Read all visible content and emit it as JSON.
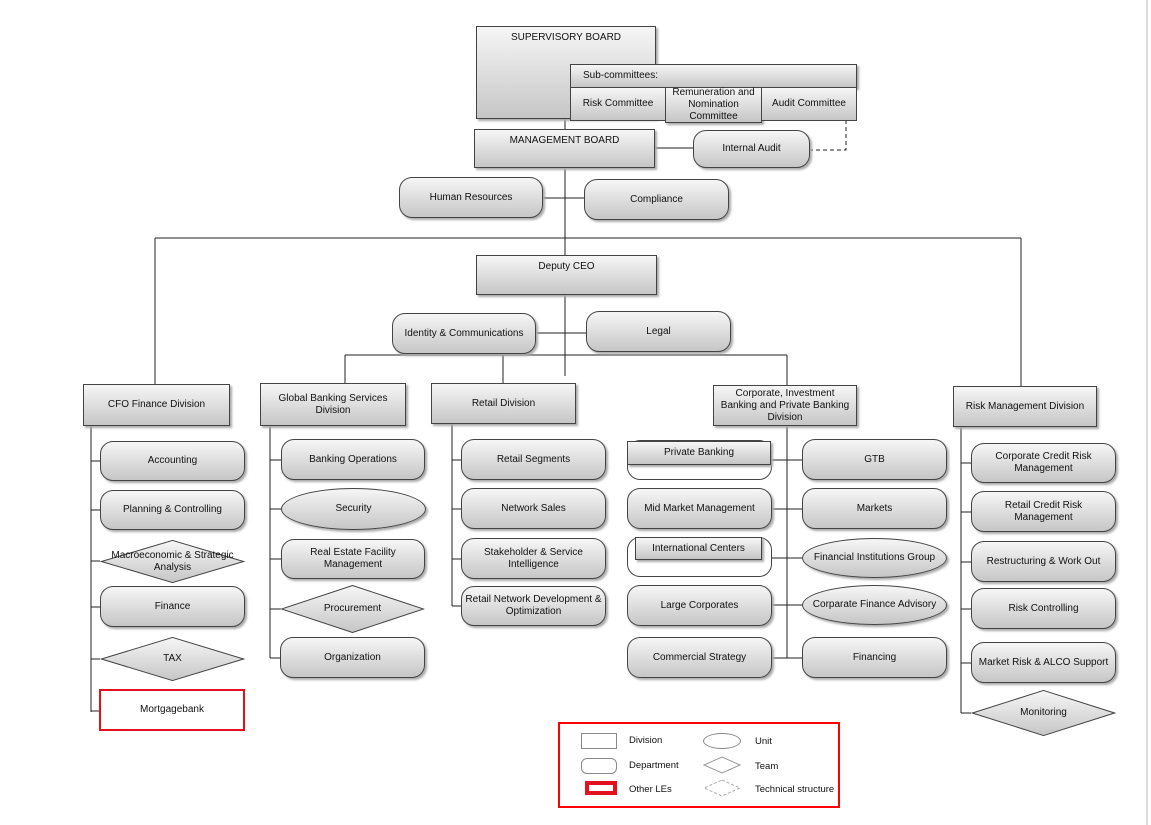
{
  "board": {
    "supervisory": "SUPERVISORY BOARD",
    "subcommittees_label": "Sub-committees:",
    "subcommittees": [
      "Risk Committee",
      "Remuneration and Nomination Committee",
      "Audit Committee"
    ],
    "management": "MANAGEMENT BOARD",
    "internal_audit": "Internal Audit",
    "human_resources": "Human Resources",
    "compliance": "Compliance",
    "deputy_ceo": "Deputy CEO",
    "identity": "Identity & Communications",
    "legal": "Legal"
  },
  "divisions": {
    "cfo": {
      "title": "CFO Finance Division",
      "items": [
        "Accounting",
        "Planning & Controlling",
        "Macroeconomic & Strategic Analysis",
        "Finance",
        "TAX",
        "Mortgagebank"
      ]
    },
    "gbs": {
      "title": "Global Banking Services Division",
      "items": [
        "Banking Operations",
        "Security",
        "Real Estate Facility Management",
        "Procurement",
        "Organization"
      ]
    },
    "retail": {
      "title": "Retail Division",
      "items": [
        "Retail Segments",
        "Network Sales",
        "Stakeholder & Service Intelligence",
        "Retail Network Development & Optimization"
      ]
    },
    "corporate": {
      "title": "Corporate, Investment Banking and Private Banking Division",
      "left": [
        "Private Banking",
        "Mid Market Management",
        "International Centers",
        "Large Corporates",
        "Commercial Strategy"
      ],
      "right": [
        "GTB",
        "Markets",
        "Financial Institutions Group",
        "Corparate Finance Advisory",
        "Financing"
      ]
    },
    "risk": {
      "title": "Risk Management Division",
      "items": [
        "Corporate Credit Risk Management",
        "Retail Credit Risk Management",
        "Restructuring & Work Out",
        "Risk Controlling",
        "Market Risk & ALCO Support",
        "Monitoring"
      ]
    }
  },
  "legend": {
    "division": "Division",
    "department": "Department",
    "other": "Other LEs",
    "unit": "Unit",
    "team": "Team",
    "technical": "Technical structure"
  },
  "colors": {
    "other_le_border": "#e3101e",
    "legend_border": "#ff0000",
    "node_fill": "#d8d8d8"
  }
}
